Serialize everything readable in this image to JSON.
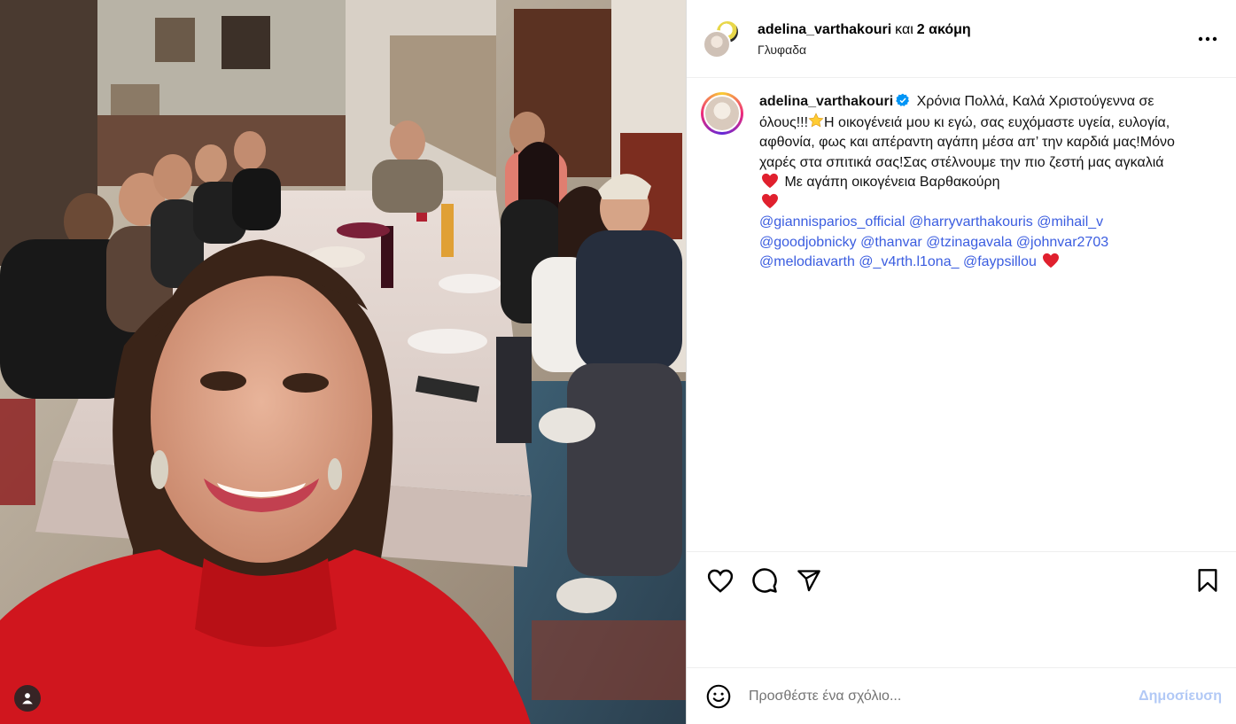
{
  "header": {
    "username": "adelina_varthakouri",
    "and_text": "και",
    "others_text": "2 ακόμη",
    "location": "Γλυφαδα"
  },
  "caption": {
    "username": "adelina_varthakouri",
    "text_part1": "Χρόνια Πολλά, Καλά Χριστούγεννα σε όλους!!!",
    "text_part2": "Η οικογένειά μου κι εγώ, σας ευχόμαστε υγεία, ευλογία, αφθονία, φως και απέραντη αγάπη μέσα απ’ την καρδιά μας!Μόνο χαρές στα σπιτικά σας!Σας στέλνουμε την πιο ζεστή μας αγκαλιά",
    "text_part3": "Με αγάπη οικογένεια Βαρθακούρη",
    "mentions": [
      "@giannisparios_official",
      "@harryvarthakouris",
      "@mihail_v",
      "@goodjobnicky",
      "@thanvar",
      "@tzinagavala",
      "@johnvar2703",
      "@melodiavarth",
      "@_v4rth.l1ona_",
      "@faypsillou"
    ]
  },
  "comment": {
    "placeholder": "Προσθέστε ένα σχόλιο...",
    "post_label": "Δημοσίευση"
  },
  "colors": {
    "mention": "#3b5de0",
    "post_button_disabled": "#b2c9f6",
    "heart": "#e0202e",
    "verified": "#0095f6"
  },
  "icons": [
    "tag-user-icon",
    "more-options-icon",
    "verified-badge-icon",
    "like-heart-icon",
    "comment-icon",
    "share-icon",
    "save-bookmark-icon",
    "emoji-icon"
  ]
}
